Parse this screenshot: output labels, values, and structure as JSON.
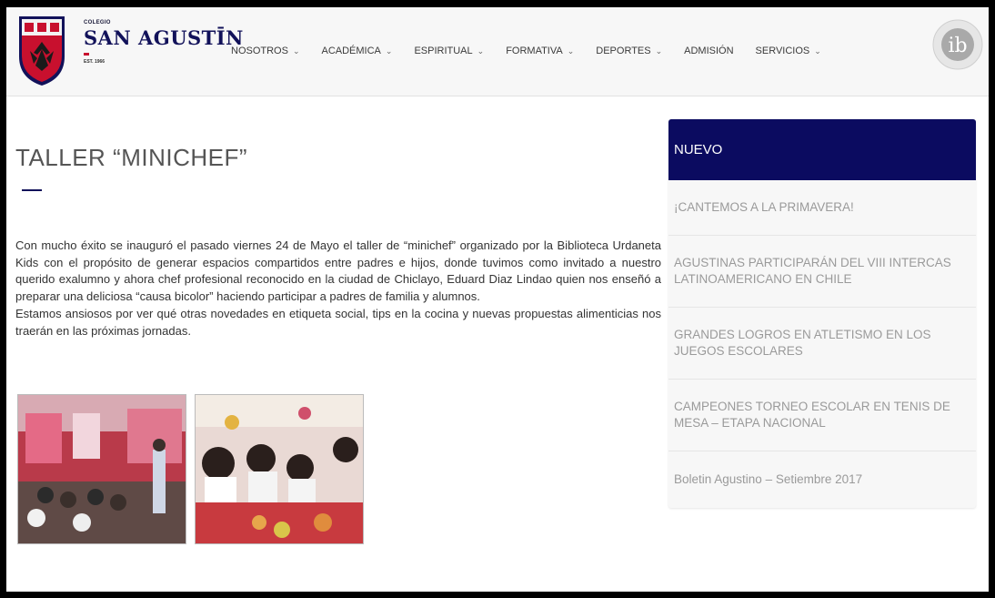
{
  "header": {
    "brand_small": "COLEGIO",
    "brand_name": "SAN AGUSTĪN",
    "brand_est": "EST. 1966",
    "nav": [
      {
        "label": "NOSOTROS",
        "dropdown": true
      },
      {
        "label": "ACADÉMICA",
        "dropdown": true
      },
      {
        "label": "ESPIRITUAL",
        "dropdown": true
      },
      {
        "label": "FORMATIVA",
        "dropdown": true
      },
      {
        "label": "DEPORTES",
        "dropdown": true
      },
      {
        "label": "ADMISIÓN",
        "dropdown": false
      },
      {
        "label": "SERVICIOS",
        "dropdown": true
      }
    ],
    "ib_logo_letters": "ib"
  },
  "article": {
    "title": "TALLER “MINICHEF”",
    "paragraph_1": "Con mucho éxito se inauguró el pasado viernes 24 de Mayo el taller de “minichef” organizado por la Biblioteca Urdaneta Kids con el propósito de generar espacios compartidos entre padres e hijos, donde tuvimos como invitado a nuestro querido exalumno y ahora chef profesional reconocido en la ciudad de Chiclayo, Eduard Diaz Lindao quien nos enseñó a preparar una deliciosa “causa bicolor” haciendo participar a padres de familia y alumnos.",
    "paragraph_2": "Estamos ansiosos por ver qué otras novedades en etiqueta social, tips en la cocina y nuevas propuestas alimenticias nos traerán en las próximas jornadas."
  },
  "sidebar": {
    "heading": "NUEVO",
    "items": [
      "¡CANTEMOS A LA PRIMAVERA!",
      "AGUSTINAS PARTICIPARÁN DEL VIII INTERCAS LATINOAMERICANO EN CHILE",
      "GRANDES LOGROS EN ATLETISMO EN LOS JUEGOS ESCOLARES",
      "CAMPEONES TORNEO ESCOLAR EN TENIS DE MESA – ETAPA NACIONAL",
      "Boletin Agustino – Setiembre 2017"
    ]
  },
  "colors": {
    "brand_navy": "#0b0b60",
    "brand_red": "#c8102e"
  }
}
